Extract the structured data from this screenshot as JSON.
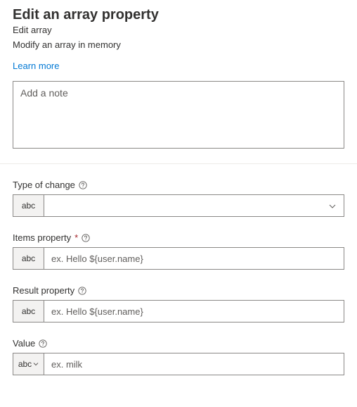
{
  "header": {
    "title": "Edit an array property",
    "subtitle": "Edit array",
    "description": "Modify an array in memory",
    "learn_more": "Learn more"
  },
  "note": {
    "placeholder": "Add a note"
  },
  "prefix": {
    "abc": "abc"
  },
  "fields": {
    "type_of_change": {
      "label": "Type of change",
      "value": ""
    },
    "items_property": {
      "label": "Items property",
      "placeholder": "ex. Hello ${user.name}"
    },
    "result_property": {
      "label": "Result property",
      "placeholder": "ex. Hello ${user.name}"
    },
    "value": {
      "label": "Value",
      "placeholder": "ex. milk"
    }
  }
}
